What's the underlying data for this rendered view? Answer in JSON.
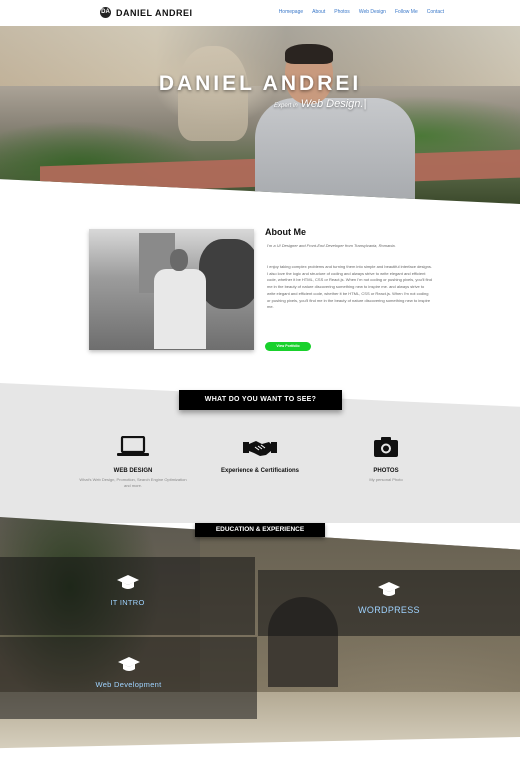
{
  "nav": {
    "brand": "DANIEL ANDREI",
    "brand_logo": "DA",
    "links": [
      "Homepage",
      "About",
      "Photos",
      "Web Design",
      "Follow Me",
      "Contact"
    ]
  },
  "hero": {
    "title": "DANIEL ANDREI",
    "subtitle_prefix": "Expert in",
    "subtitle_highlight": "Web Design.|"
  },
  "about": {
    "heading": "About Me",
    "tagline": "I'm a UI Designer and Front-End Developer from Transylvania, Romania.",
    "body": "I enjoy taking complex problems and turning them into simple and beautiful interface designs. I also love the logic and structure of coding and always strive to write elegant and efficient code, whether it be HTML, CSS or React.js. When I'm not coding or pushing pixels, you'll find me in the beauty of nature discovering something new to inspire me. and always strive to write elegant and efficient code, whether it be HTML, CSS or React.js. When I'm not coding or pushing pixels, you'll find me in the beauty of nature discovering something new to inspire me.",
    "button": "View Portfolio"
  },
  "services": {
    "heading": "WHAT DO YOU WANT TO SEE?",
    "items": [
      {
        "icon": "laptop-icon",
        "title": "WEB DESIGN",
        "desc": "What's Web Design, Promotion, Search Engine Optimization and more."
      },
      {
        "icon": "handshake-icon",
        "title": "Experience & Certifications",
        "desc": ""
      },
      {
        "icon": "camera-icon",
        "title": "PHOTOS",
        "desc": "My personal Photo"
      }
    ]
  },
  "education": {
    "heading": "EDUCATION & EXPERIENCE",
    "items": [
      {
        "icon": "graduation-cap-icon",
        "label": "IT INTRO"
      },
      {
        "icon": "graduation-cap-icon",
        "label": "WORDPRESS"
      },
      {
        "icon": "graduation-cap-icon",
        "label": "Web Development"
      }
    ]
  },
  "colors": {
    "accent_green": "#19d12c",
    "link_blue": "#3a78c9",
    "label_blue": "#9fd3ff"
  }
}
